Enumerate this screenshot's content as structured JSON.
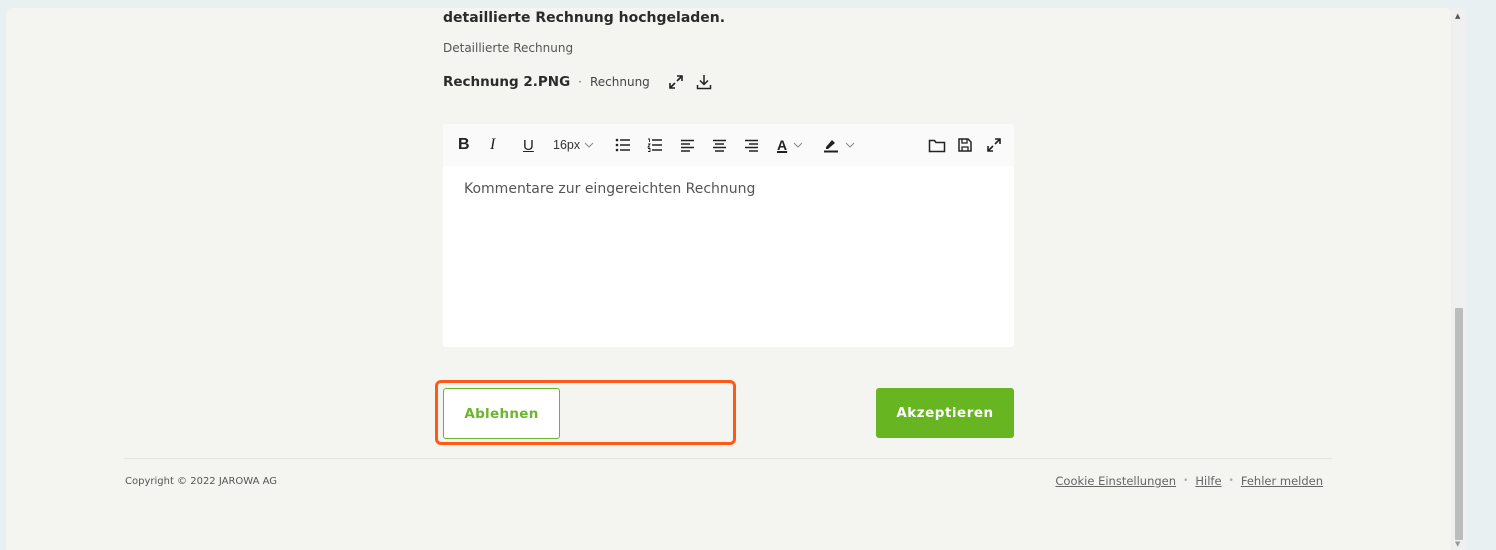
{
  "section": {
    "heading": "detaillierte Rechnung hochgeladen.",
    "sublabel": "Detaillierte Rechnung"
  },
  "file": {
    "name": "Rechnung 2.PNG",
    "separator": "·",
    "type": "Rechnung",
    "expand_icon": "expand-icon",
    "download_icon": "download-icon"
  },
  "editor": {
    "toolbar": {
      "bold": "B",
      "italic": "I",
      "underline": "U",
      "font_size": "16px",
      "text_color_letter": "A"
    },
    "placeholder": "Kommentare zur eingereichten Rechnung"
  },
  "actions": {
    "reject_label": "Ablehnen",
    "accept_label": "Akzeptieren"
  },
  "footer": {
    "copyright": "Copyright © 2022 JAROWA AG",
    "links": [
      "Cookie Einstellungen",
      "Hilfe",
      "Fehler melden"
    ],
    "separator": "•"
  },
  "colors": {
    "accent_green": "#67b521",
    "highlight_orange": "#fc5a16"
  }
}
